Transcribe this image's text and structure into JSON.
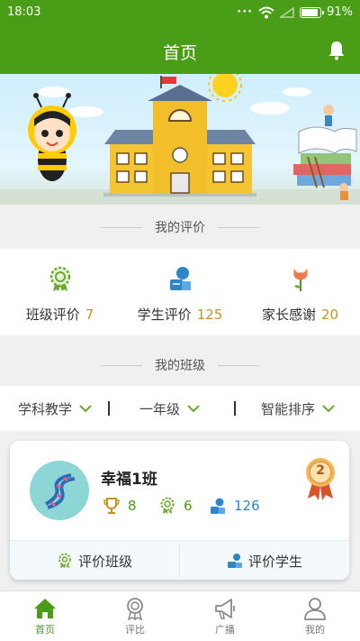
{
  "status_bar": {
    "time": "18:03",
    "battery": "91%",
    "battery_level": 0.91
  },
  "header": {
    "title": "首页",
    "bell_icon": "bell-icon"
  },
  "sections": {
    "my_reviews": "我的评价",
    "my_classes": "我的班级"
  },
  "stats": [
    {
      "label": "班级评价",
      "value": "7",
      "icon": "medal-icon"
    },
    {
      "label": "学生评价",
      "value": "125",
      "icon": "student-icon"
    },
    {
      "label": "家长感谢",
      "value": "20",
      "icon": "flower-icon"
    }
  ],
  "filters": [
    {
      "label": "学科教学",
      "icon": "chevron-down-icon"
    },
    {
      "label": "一年级",
      "icon": "chevron-down-icon"
    },
    {
      "label": "智能排序",
      "icon": "chevron-down-icon"
    }
  ],
  "class_card": {
    "name": "幸福1班",
    "rank": "2",
    "trophies": "8",
    "medals": "6",
    "students": "126",
    "actions": {
      "review_class": "评价班级",
      "review_students": "评价学生"
    }
  },
  "tabs": [
    {
      "label": "首页",
      "icon": "home-icon",
      "active": true
    },
    {
      "label": "评比",
      "icon": "award-icon",
      "active": false
    },
    {
      "label": "广播",
      "icon": "megaphone-icon",
      "active": false
    },
    {
      "label": "我的",
      "icon": "user-icon",
      "active": false
    }
  ],
  "colors": {
    "primary": "#4a9d16",
    "accent_number": "#c7931d",
    "blue": "#2e86c9"
  }
}
